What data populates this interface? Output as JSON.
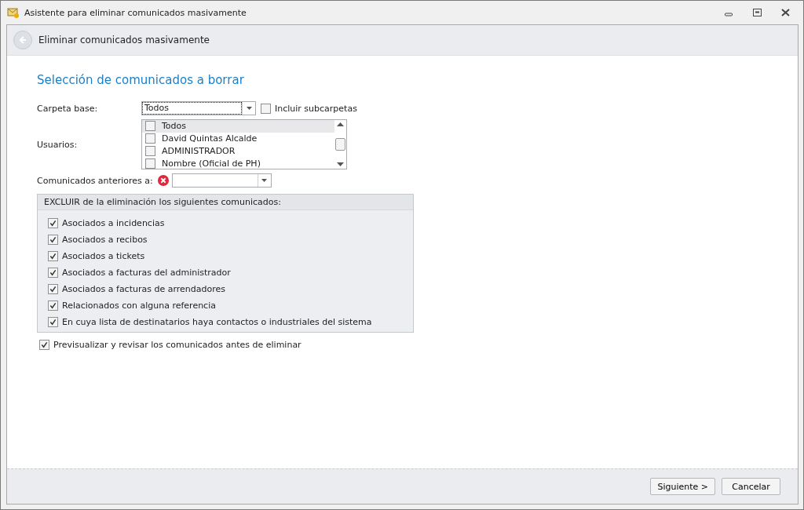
{
  "window": {
    "title": "Asistente para eliminar comunicados masivamente"
  },
  "header": {
    "title": "Eliminar comunicados masivamente"
  },
  "section_title": "Selección de comunicados a borrar",
  "carpeta": {
    "label": "Carpeta base:",
    "value": "Todos",
    "include_label": "Incluir subcarpetas",
    "include_checked": false
  },
  "usuarios": {
    "label": "Usuarios:",
    "items": [
      {
        "label": "Todos",
        "checked": false,
        "selected": true
      },
      {
        "label": "David Quintas Alcalde",
        "checked": false,
        "selected": false
      },
      {
        "label": "ADMINISTRADOR",
        "checked": false,
        "selected": false
      },
      {
        "label": "Nombre (Oficial de PH)",
        "checked": false,
        "selected": false
      }
    ]
  },
  "fecha": {
    "label": "Comunicados anteriores a:",
    "error": true
  },
  "excluir": {
    "title": "EXCLUIR de la eliminación los siguientes comunicados:",
    "items": [
      {
        "label": "Asociados a incidencias",
        "checked": true
      },
      {
        "label": "Asociados a recibos",
        "checked": true
      },
      {
        "label": "Asociados a tickets",
        "checked": true
      },
      {
        "label": "Asociados a facturas del administrador",
        "checked": true
      },
      {
        "label": "Asociados a facturas de arrendadores",
        "checked": true
      },
      {
        "label": "Relacionados con alguna referencia",
        "checked": true
      },
      {
        "label": "En cuya lista de destinatarios haya contactos o industriales del sistema",
        "checked": true
      }
    ]
  },
  "preview": {
    "label": "Previsualizar y revisar los comunicados antes de eliminar",
    "checked": true
  },
  "buttons": [
    "Siguiente >",
    "Cancelar"
  ]
}
